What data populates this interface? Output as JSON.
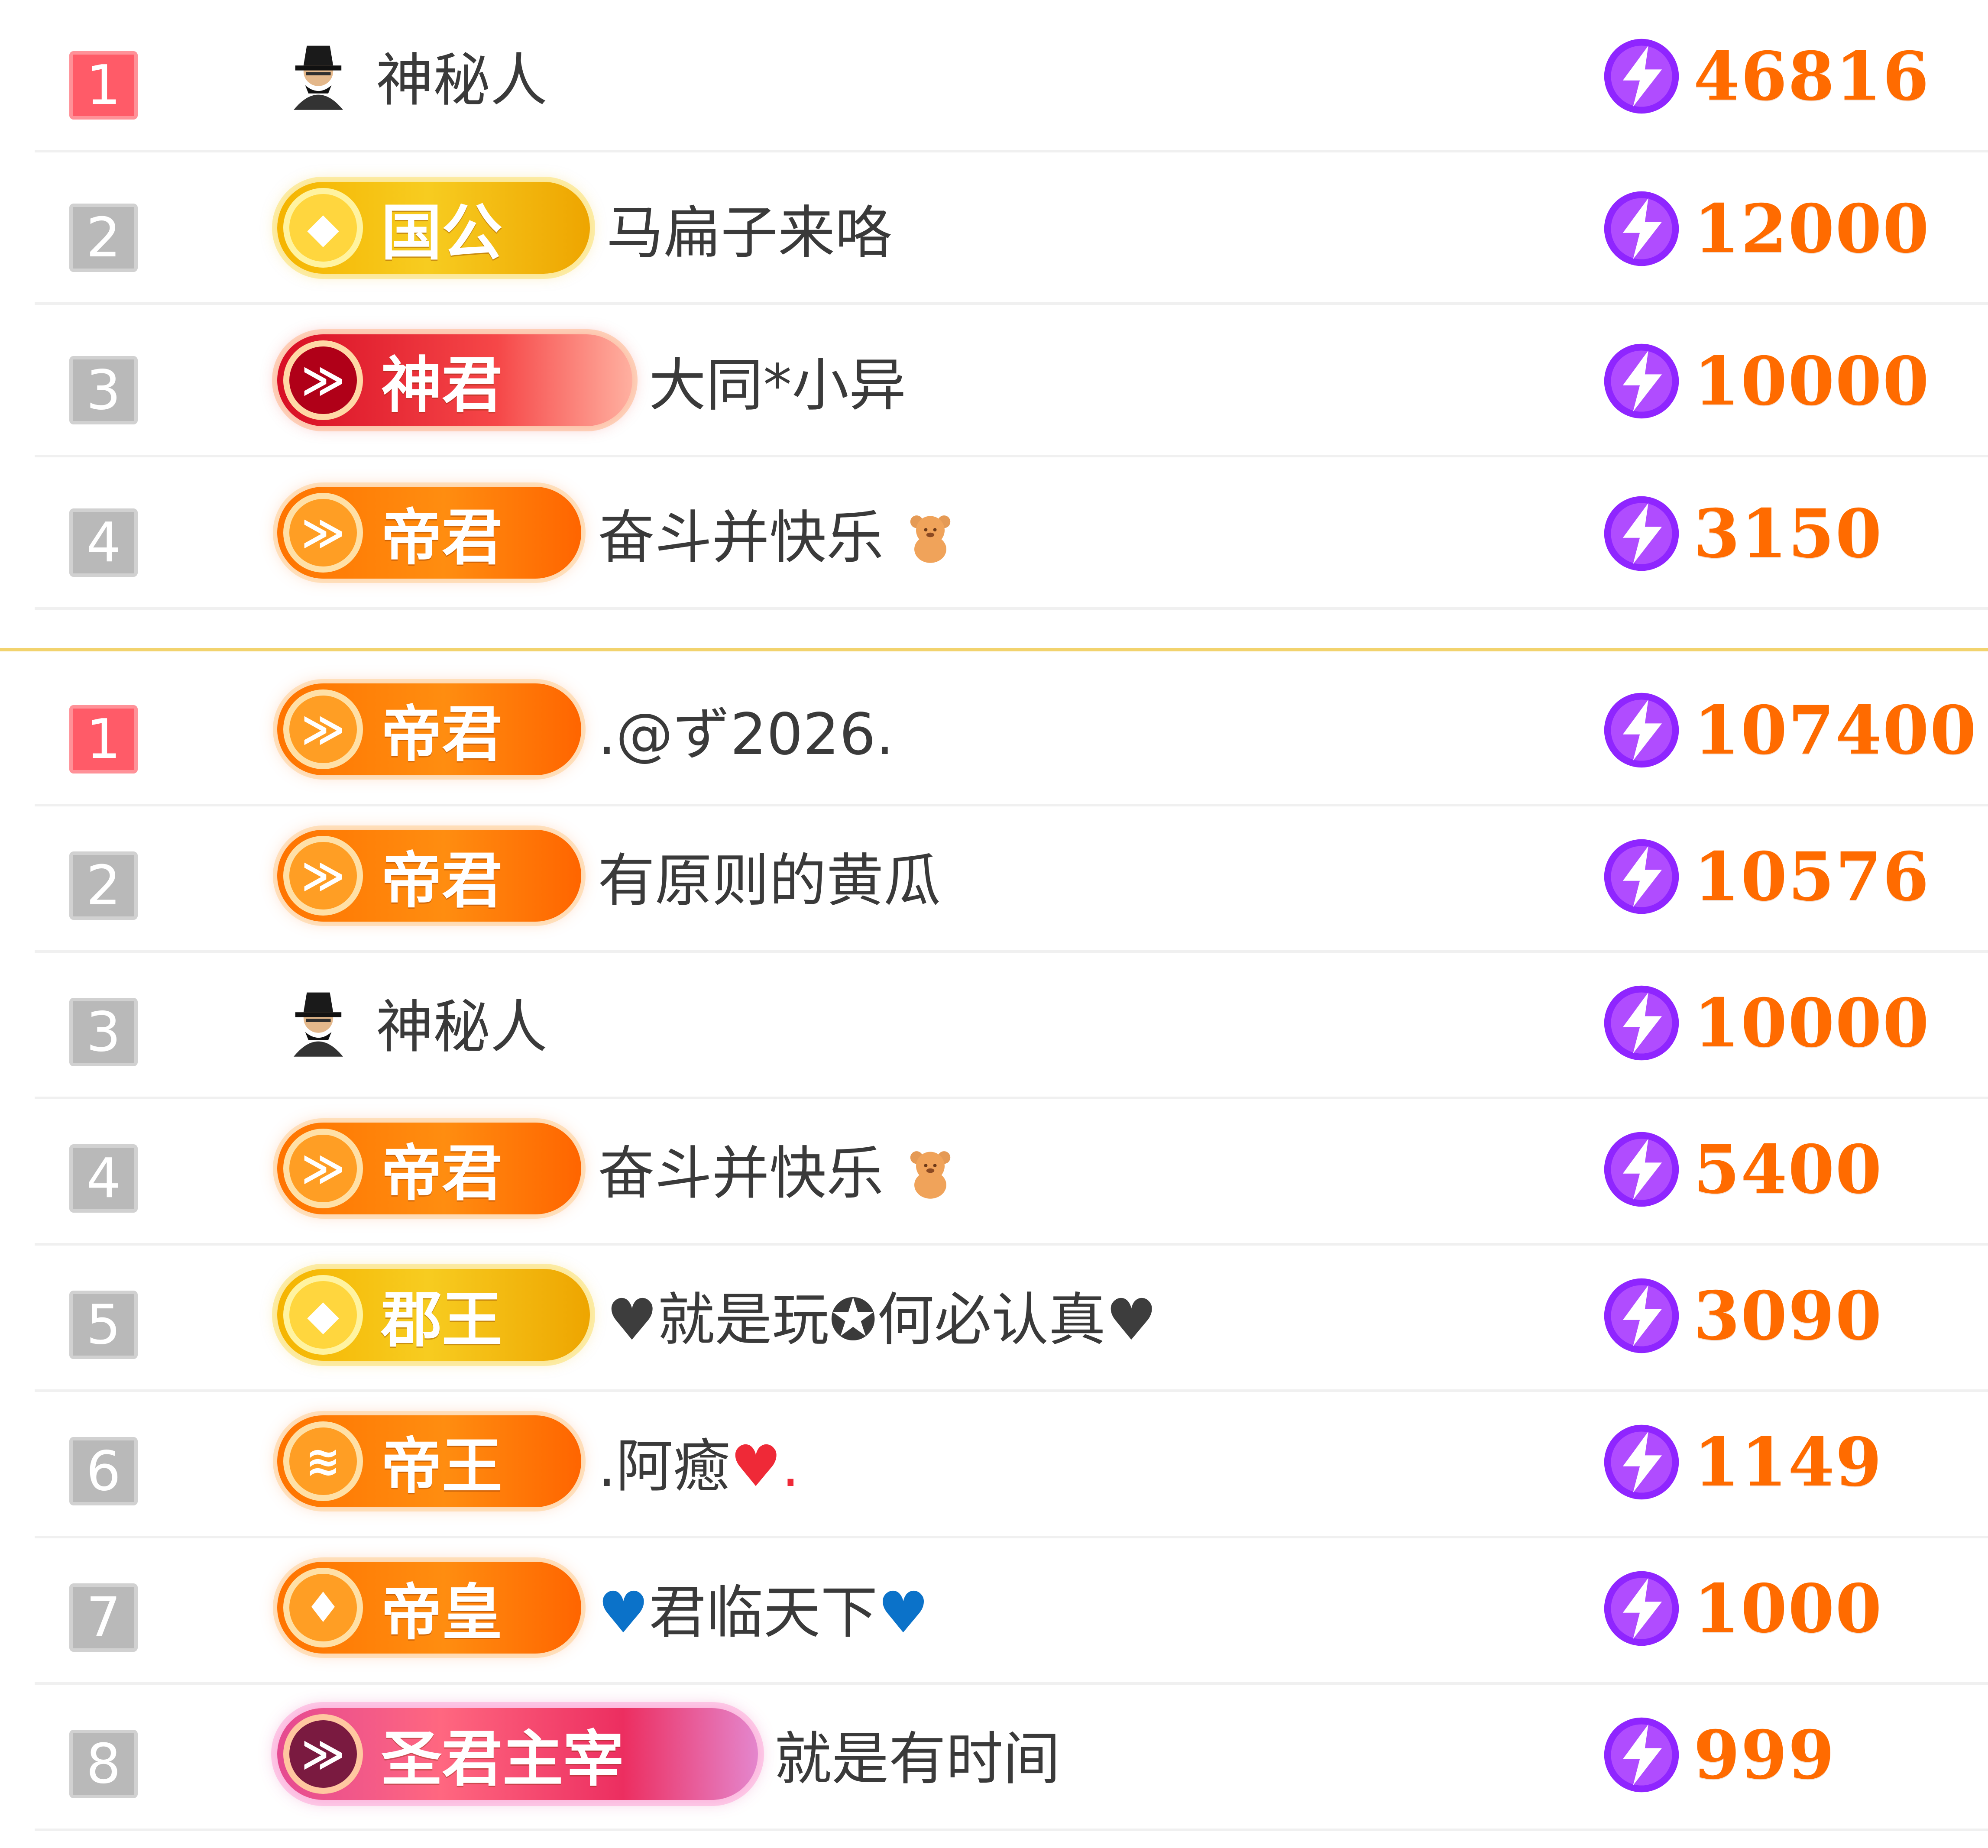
{
  "top_list": [
    {
      "rank": "1",
      "avatar": "mystery-user-icon",
      "badge": null,
      "name": "神秘人",
      "score": "46816"
    },
    {
      "rank": "2",
      "badge": {
        "label": "国公",
        "style": "gold"
      },
      "name": "马扁子来咯",
      "score": "12000"
    },
    {
      "rank": "3",
      "badge": {
        "label": "神君",
        "style": "red"
      },
      "name": "大同*小异",
      "score": "10000"
    },
    {
      "rank": "4",
      "badge": {
        "label": "帝君",
        "style": "orange"
      },
      "name": "奋斗并快乐",
      "name_icon": "bear-icon",
      "score": "3150"
    }
  ],
  "bottom_list": [
    {
      "rank": "1",
      "badge": {
        "label": "帝君",
        "style": "orange"
      },
      "name": ".@ず2026.",
      "score": "107400"
    },
    {
      "rank": "2",
      "badge": {
        "label": "帝君",
        "style": "orange"
      },
      "name": "有原则的黄瓜",
      "score": "10576"
    },
    {
      "rank": "3",
      "avatar": "mystery-user-icon",
      "badge": null,
      "name": "神秘人",
      "score": "10000"
    },
    {
      "rank": "4",
      "badge": {
        "label": "帝君",
        "style": "orange"
      },
      "name": "奋斗并快乐",
      "name_icon": "bear-icon",
      "score": "5400"
    },
    {
      "rank": "5",
      "badge": {
        "label": "郡王",
        "style": "gold"
      },
      "name_prefix": "♥",
      "name": "就是玩✪何必认真",
      "name_suffix": "♥",
      "score": "3090"
    },
    {
      "rank": "6",
      "badge": {
        "label": "帝王",
        "style": "orange"
      },
      "name": ".阿癒",
      "name_suffix": "♥.",
      "score": "1149"
    },
    {
      "rank": "7",
      "badge": {
        "label": "帝皇",
        "style": "orange-light"
      },
      "name_prefix": "♥",
      "name": "君临天下",
      "name_suffix": "♥",
      "score": "1000"
    },
    {
      "rank": "8",
      "badge": {
        "label": "圣君主宰",
        "style": "supreme"
      },
      "name": "就是有时间",
      "score": "999"
    }
  ],
  "colors": {
    "score": "#ff6b00",
    "rank_first": "#ff5b68",
    "rank_other": "#b9b9b9",
    "divider": "#f2d36e",
    "bolt_purple": "#8f25ff"
  },
  "icons": {
    "score_icon": "lightning-icon"
  }
}
